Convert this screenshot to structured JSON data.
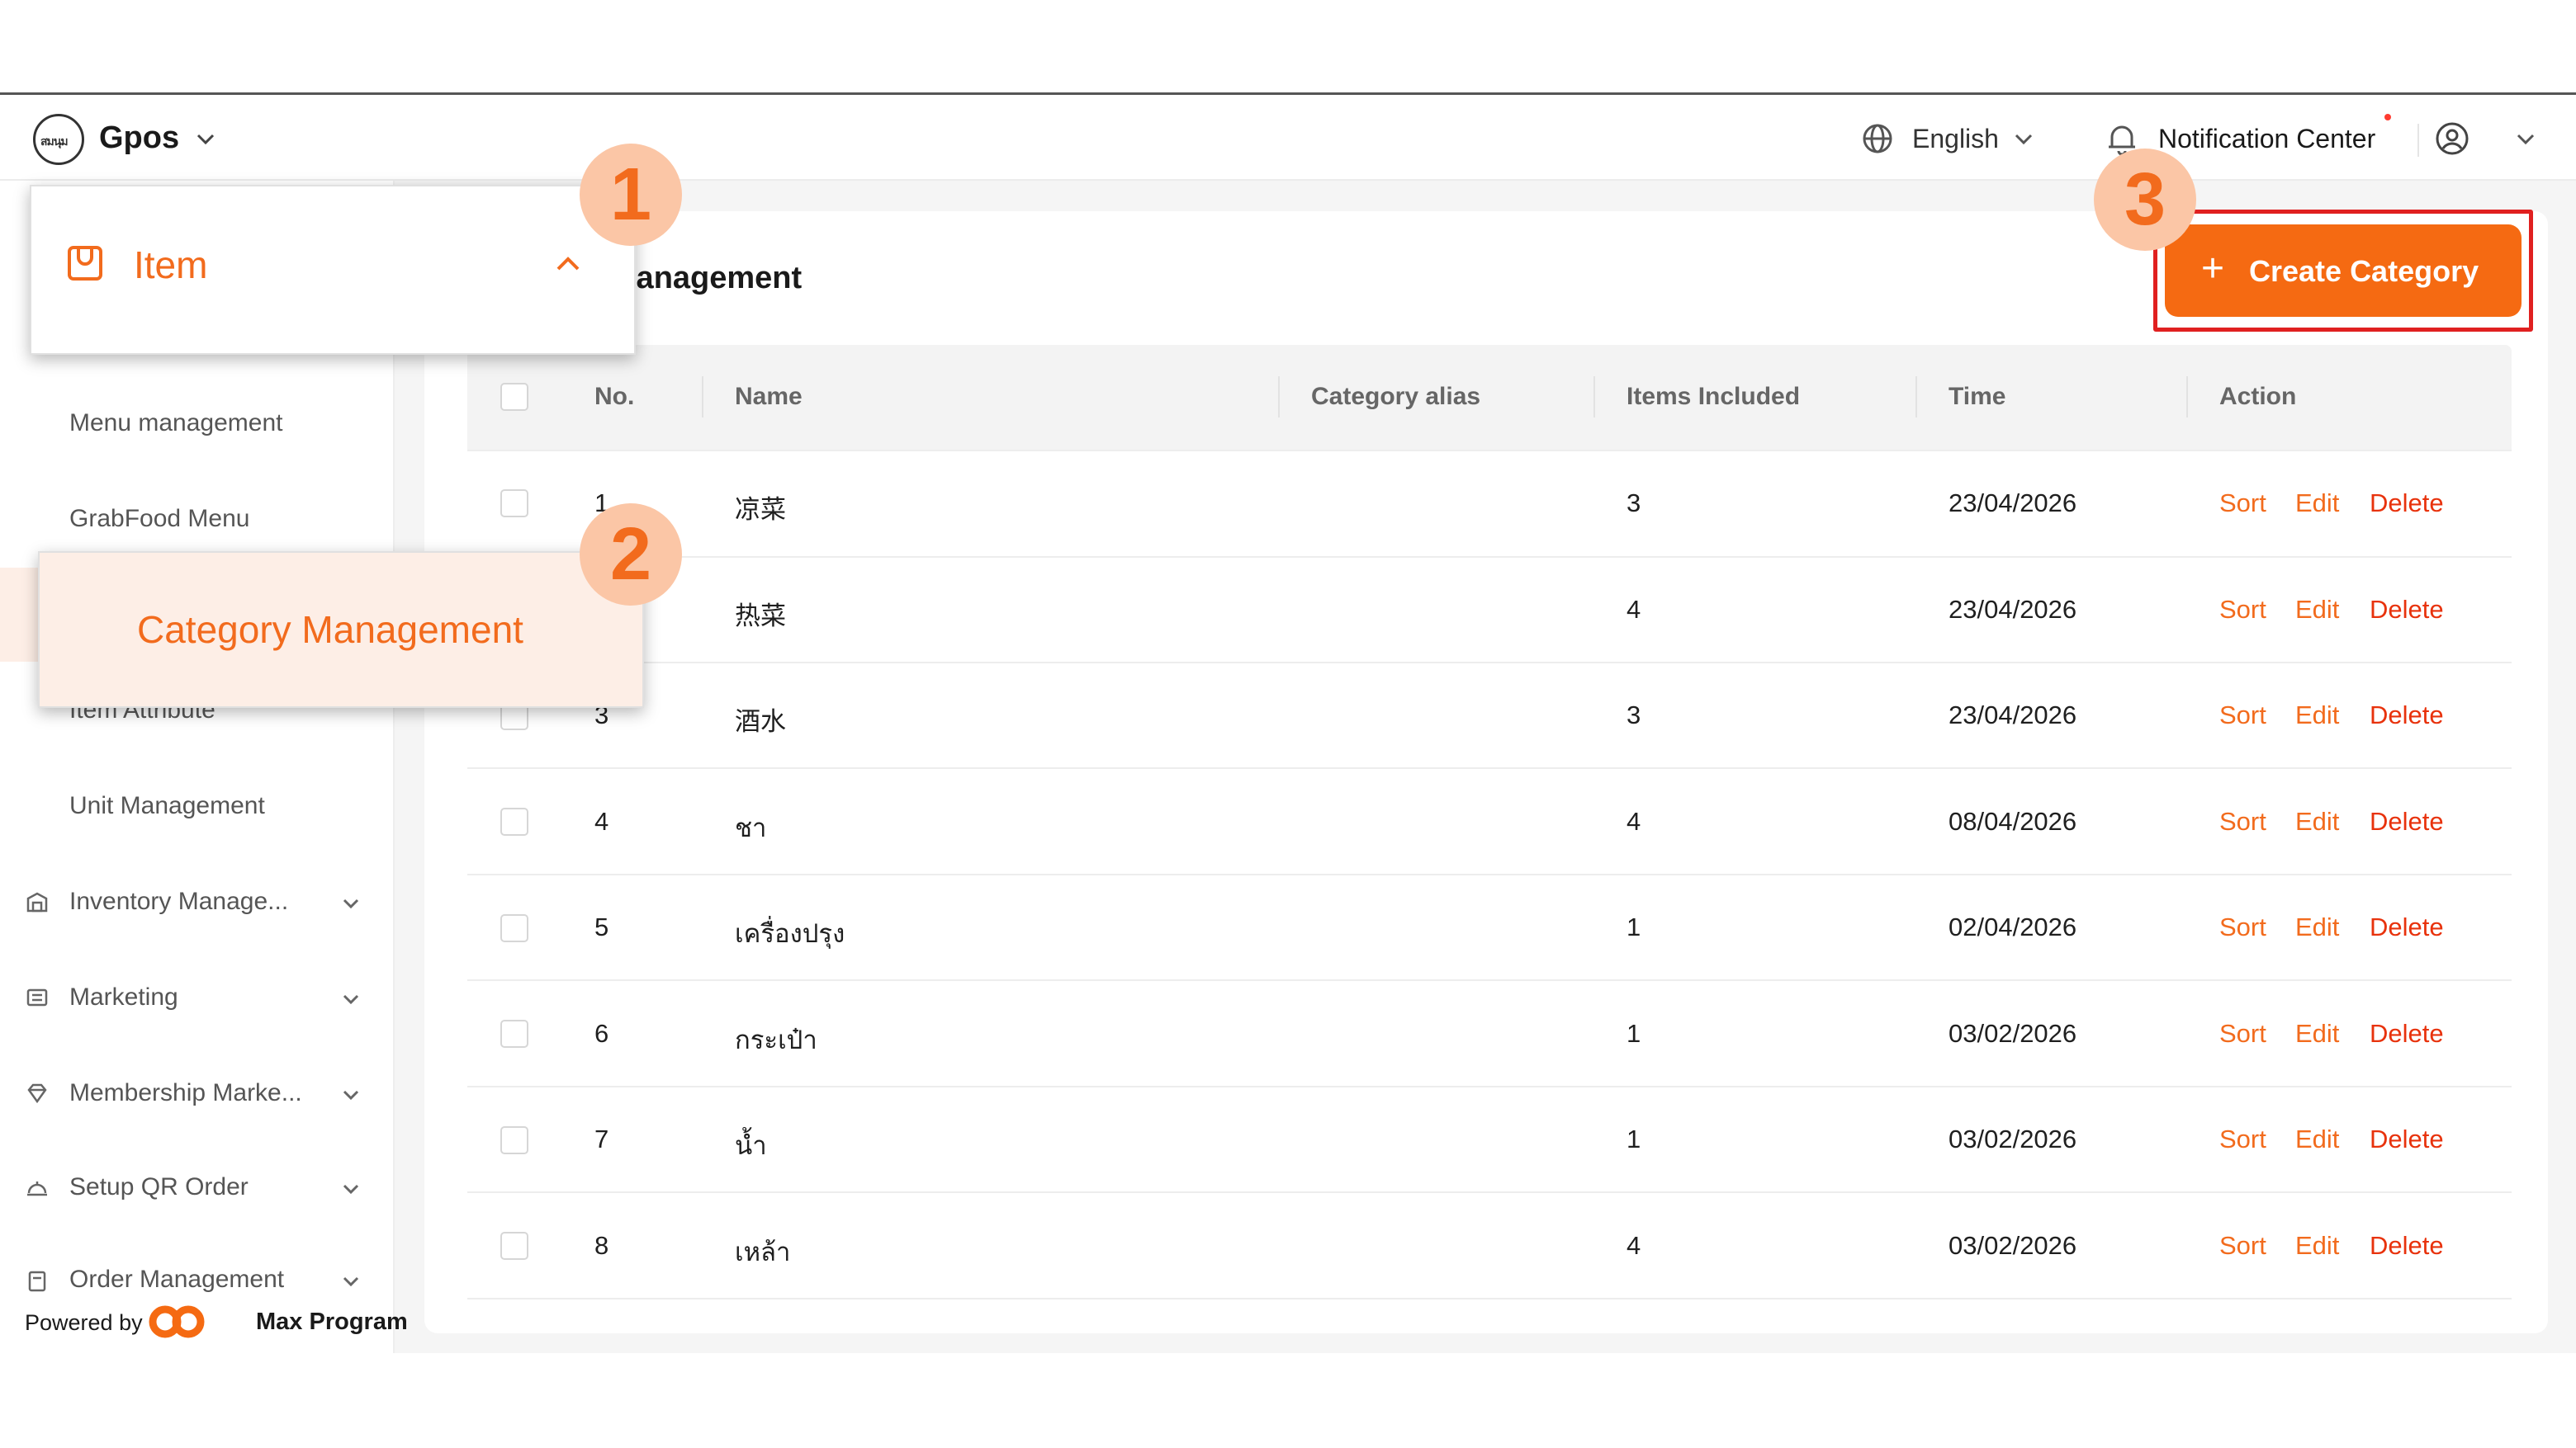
{
  "topbar": {
    "logo_text": "สมนุม",
    "brand": "Gpos",
    "language": "English",
    "notification": "Notification Center"
  },
  "sidebar": {
    "active_group": "Item",
    "submenu": [
      {
        "label": "Menu management"
      },
      {
        "label": "GrabFood Menu"
      },
      {
        "label": "Category Management"
      },
      {
        "label": "Item Attribute"
      },
      {
        "label": "Unit Management"
      }
    ],
    "groups": [
      {
        "label": "Inventory Manage...",
        "icon": "warehouse-icon"
      },
      {
        "label": "Marketing",
        "icon": "ticket-icon"
      },
      {
        "label": "Membership Marke...",
        "icon": "diamond-icon"
      },
      {
        "label": "Setup QR Order",
        "icon": "cloche-icon"
      },
      {
        "label": "Order Management",
        "icon": "clipboard-icon"
      }
    ],
    "powered_by": "Powered by",
    "company": "Max Program"
  },
  "page": {
    "title": "Category Management",
    "title_visible": "lanagement",
    "create_label": "Create Category"
  },
  "table": {
    "columns": [
      "No.",
      "Name",
      "Category alias",
      "Items Included",
      "Time",
      "Action"
    ],
    "rows": [
      {
        "no": "1",
        "name": "凉菜",
        "alias": "",
        "items": "3",
        "time": "23/04/2026"
      },
      {
        "no": "2",
        "name": "热菜",
        "alias": "",
        "items": "4",
        "time": "23/04/2026"
      },
      {
        "no": "3",
        "name": "酒水",
        "alias": "",
        "items": "3",
        "time": "23/04/2026"
      },
      {
        "no": "4",
        "name": "ชา",
        "alias": "",
        "items": "4",
        "time": "08/04/2026"
      },
      {
        "no": "5",
        "name": "เครื่องปรุง",
        "alias": "",
        "items": "1",
        "time": "02/04/2026"
      },
      {
        "no": "6",
        "name": "กระเป๋า",
        "alias": "",
        "items": "1",
        "time": "03/02/2026"
      },
      {
        "no": "7",
        "name": "น้ำ",
        "alias": "",
        "items": "1",
        "time": "03/02/2026"
      },
      {
        "no": "8",
        "name": "เหล้า",
        "alias": "",
        "items": "4",
        "time": "03/02/2026"
      }
    ],
    "actions": {
      "sort": "Sort",
      "edit": "Edit",
      "delete": "Delete"
    }
  },
  "callouts": [
    {
      "number": "1",
      "label": "Item"
    },
    {
      "number": "2",
      "label": "Category Management"
    },
    {
      "number": "3"
    }
  ],
  "colors": {
    "accent": "#f56a12",
    "delete": "#e8320c",
    "highlight_bg": "#fdeee6",
    "badge_bg": "#fbc6a6",
    "outline": "#e02020"
  }
}
